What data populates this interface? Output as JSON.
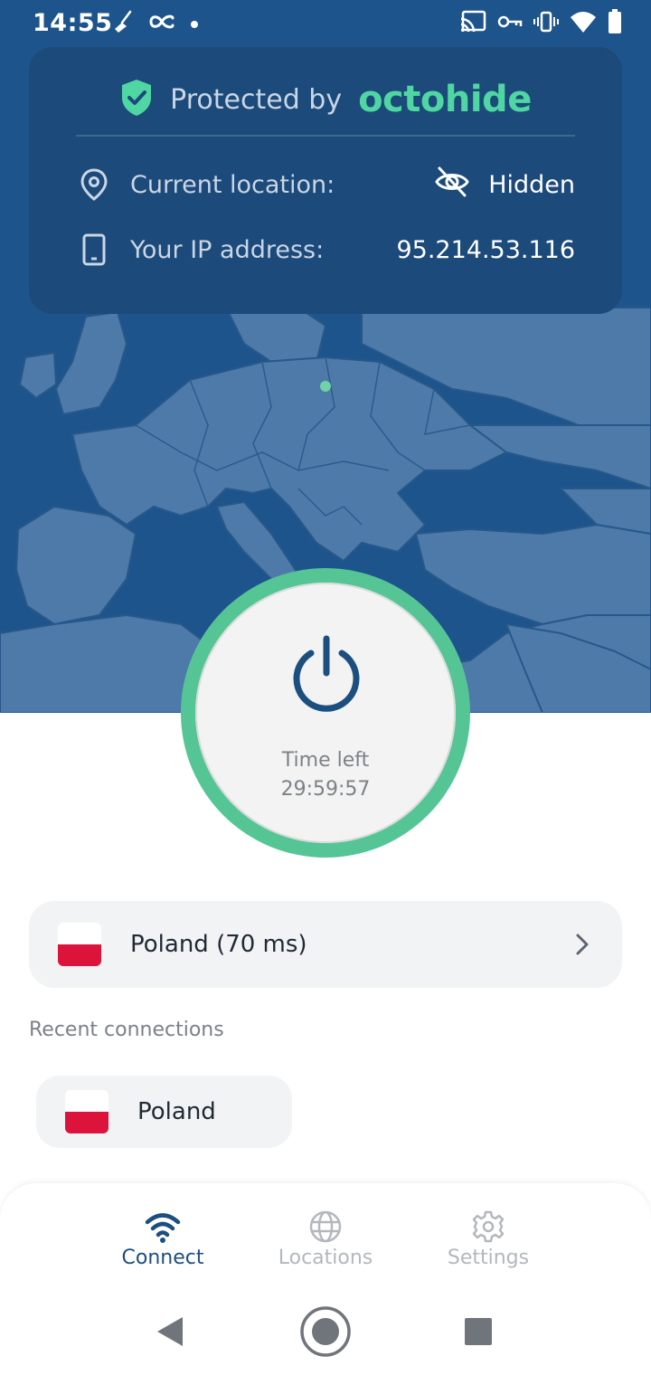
{
  "status_bar": {
    "time": "14:55",
    "left_icons": [
      "broom-icon",
      "octohide-status-icon",
      "dot-icon"
    ],
    "right_icons": [
      "cast-icon",
      "vpn-key-icon",
      "vibrate-icon",
      "wifi-icon",
      "battery-icon"
    ]
  },
  "card": {
    "protected_label": "Protected by",
    "brand": "octohide",
    "location_label": "Current location:",
    "location_value": "Hidden",
    "ip_label": "Your IP address:",
    "ip_value": "95.214.53.116"
  },
  "power": {
    "time_left_label": "Time left",
    "time_left_value": "29:59:57"
  },
  "server": {
    "label": "Poland (70 ms)",
    "flag": "poland-flag"
  },
  "recent": {
    "title": "Recent connections",
    "items": [
      {
        "label": "Poland",
        "flag": "poland-flag"
      }
    ]
  },
  "nav": {
    "items": [
      {
        "label": "Connect",
        "icon": "wifi-icon",
        "active": true
      },
      {
        "label": "Locations",
        "icon": "globe-icon",
        "active": false
      },
      {
        "label": "Settings",
        "icon": "gear-icon",
        "active": false
      }
    ]
  },
  "colors": {
    "map_background": "#1e548c",
    "land": "#4d7aa8",
    "card": "#1c4a7a",
    "accent_green": "#56c596",
    "brand_green": "#4fd6a2",
    "active_nav": "#1c4f7f",
    "inactive_nav": "#b3b8be"
  }
}
